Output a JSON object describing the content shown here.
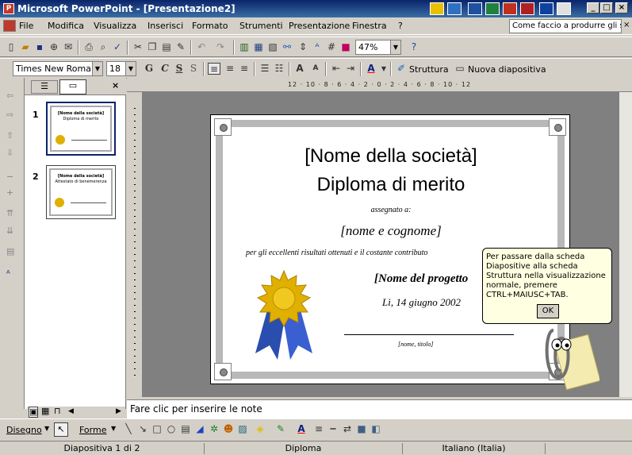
{
  "window": {
    "title": "Microsoft PowerPoint - [Presentazione2]"
  },
  "menu": {
    "items": [
      "File",
      "Modifica",
      "Visualizza",
      "Inserisci",
      "Formato",
      "Strumenti",
      "Presentazione",
      "Finestra",
      "?"
    ],
    "help_box": "Come faccio a produrre gli s"
  },
  "standard_toolbar": {
    "zoom": "47%"
  },
  "formatting_toolbar": {
    "font": "Times New Roman",
    "size": "18",
    "bold": "G",
    "italic": "C",
    "underline": "S",
    "shadow": "S",
    "design_label": "Struttura",
    "new_slide_label": "Nuova diapositiva"
  },
  "thumbnails": [
    {
      "num": "1",
      "line1": "[Nome della società]",
      "line2": "Diploma di merito"
    },
    {
      "num": "2",
      "line1": "[Nome della società]",
      "line2": "Attestato di benemerenza"
    }
  ],
  "ruler": {
    "h": "12 · 10 · 8 · 6 · 4 · 2 · 0 · 2 · 4 · 6 · 8 · 10 · 12"
  },
  "slide": {
    "company": "[Nome della società]",
    "title": "Diploma di merito",
    "assigned": "assegnato a:",
    "name": "[nome e cognome]",
    "reason": "per gli eccellenti risultati ottenuti e il costante contributo",
    "project": "[Nome del progetto",
    "date": "Lì, 14 giugno 2002",
    "signature": "[nome, titolo]"
  },
  "balloon": {
    "text": "Per passare dalla scheda Diapositive alla scheda Struttura nella visualizzazione normale, premere CTRL+MAIUSC+TAB.",
    "ok": "OK"
  },
  "notes": {
    "placeholder": "Fare clic per inserire le note"
  },
  "drawing_toolbar": {
    "draw": "Disegno",
    "shapes": "Forme"
  },
  "status": {
    "slide": "Diapositiva 1 di 2",
    "design": "Diploma",
    "language": "Italiano (Italia)"
  }
}
